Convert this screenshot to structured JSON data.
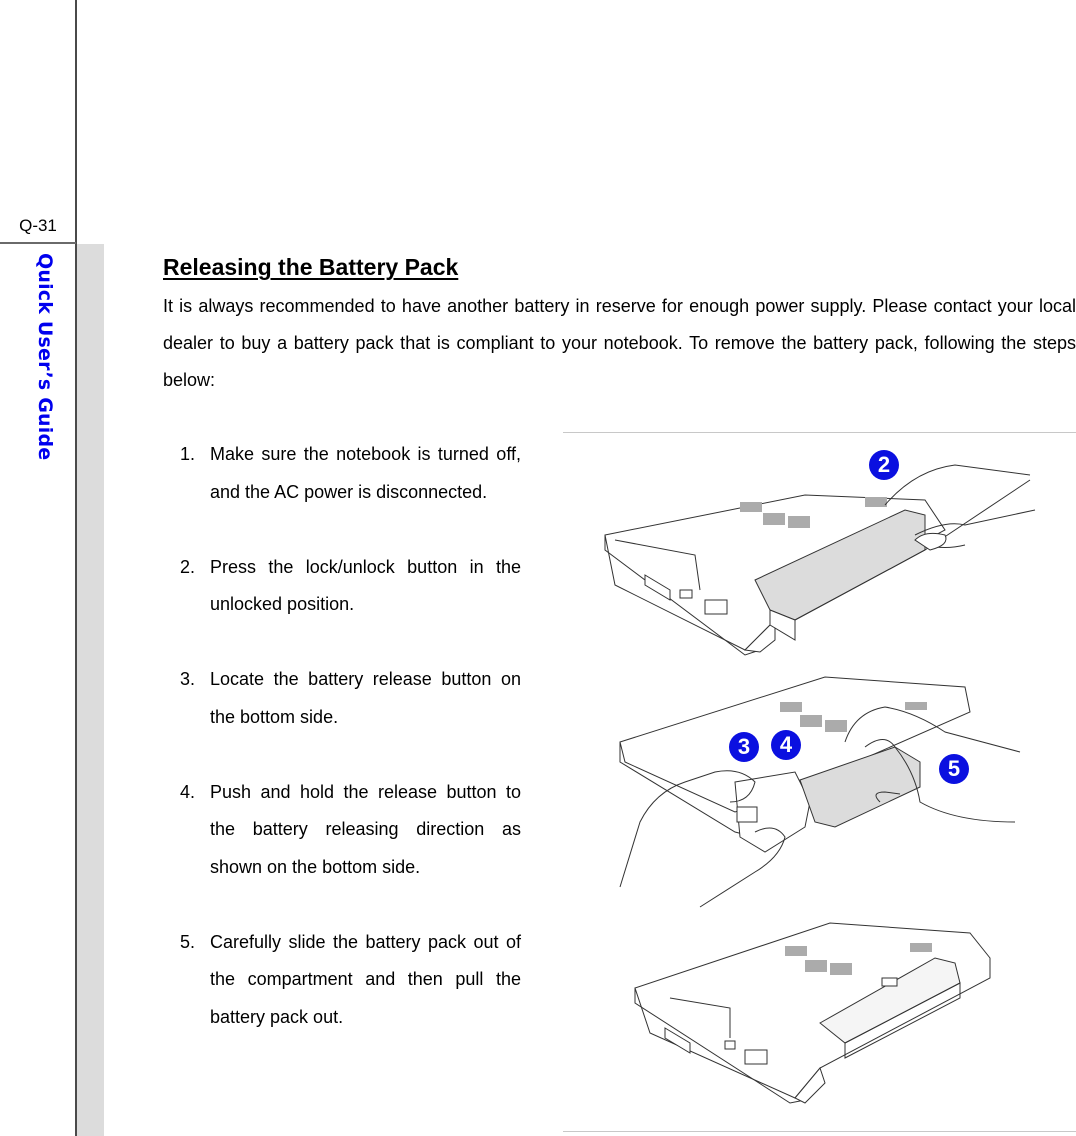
{
  "page": {
    "page_number": "Q-31",
    "side_title": "Quick User’s Guide",
    "accent_color": "#0000ee"
  },
  "section": {
    "heading": "Releasing the Battery Pack",
    "intro": "It is always recommended to have another battery in reserve for enough power supply.   Please contact your local dealer to buy a battery pack that is compliant to your notebook.   To remove the battery pack, following the steps below:"
  },
  "steps": [
    {
      "num": "1.",
      "text": "Make sure the notebook is turned off, and the AC power is disconnected."
    },
    {
      "num": "2.",
      "text": "Press the lock/unlock button in the unlocked position."
    },
    {
      "num": "3.",
      "text": "Locate the battery release button on the bottom side."
    },
    {
      "num": "4.",
      "text": "Push and hold the release button to the battery releasing direction as shown on the bottom side."
    },
    {
      "num": "5.",
      "text": "Carefully slide the battery pack out of the compartment and then pull the battery pack out."
    }
  ],
  "figures": [
    {
      "label": "notebook bottom with battery, hand pressing lock button",
      "badges": [
        "2"
      ]
    },
    {
      "label": "hands pushing release button and sliding battery out",
      "badges": [
        "3",
        "4",
        "5"
      ]
    },
    {
      "label": "notebook bottom with empty battery compartment",
      "badges": []
    }
  ],
  "badge_color": "#0b10e0"
}
